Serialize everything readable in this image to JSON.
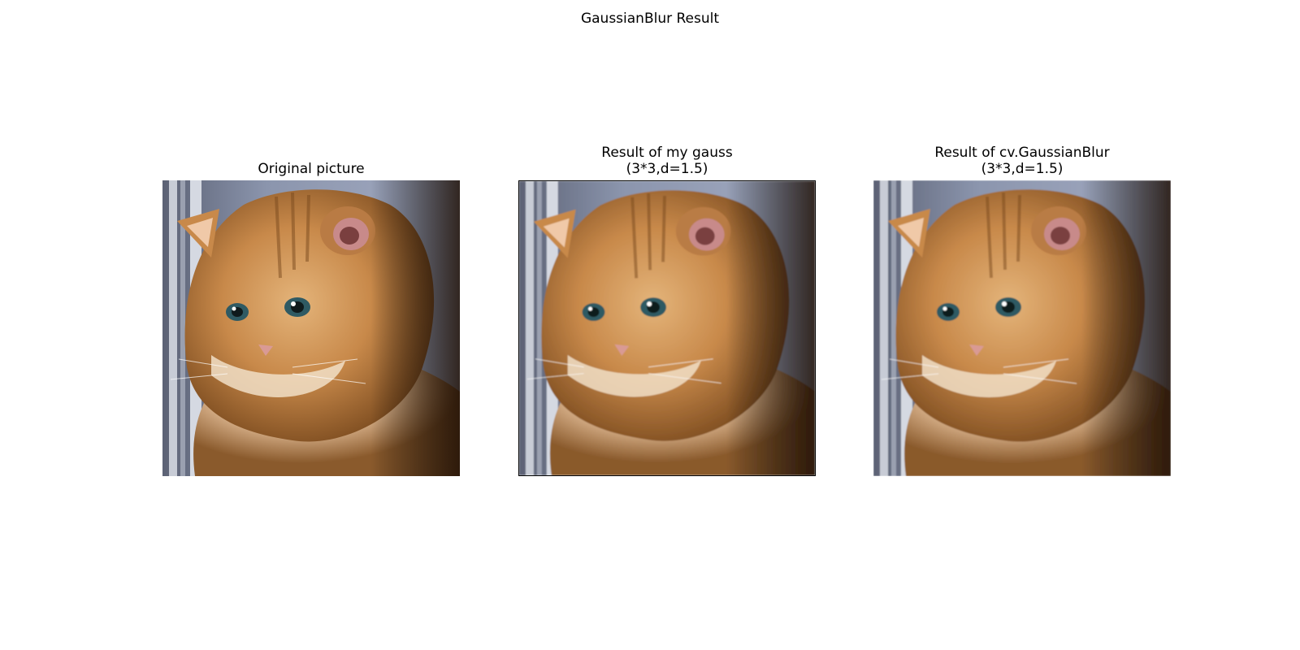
{
  "figure": {
    "title": "GaussianBlur Result"
  },
  "panels": [
    {
      "title_lines": [
        "Original picture"
      ],
      "image_description_icon": "cat-photo"
    },
    {
      "title_lines": [
        "Result of my gauss",
        "(3*3,d=1.5)"
      ],
      "image_description_icon": "cat-photo"
    },
    {
      "title_lines": [
        "Result of cv.GaussianBlur",
        "(3*3,d=1.5)"
      ],
      "image_description_icon": "cat-photo"
    }
  ],
  "colors": {
    "background_wall": "#8b95ad",
    "fur_light": "#e8c9a0",
    "fur_mid": "#c8894a",
    "fur_dark": "#7a4a1e",
    "shadow": "#2a1a10",
    "eye": "#2f5a63",
    "nose": "#d99a94",
    "window_frame": "#c8ccd6"
  }
}
